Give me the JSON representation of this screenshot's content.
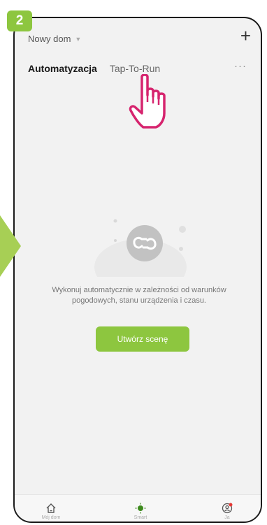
{
  "step_number": "2",
  "colors": {
    "accent": "#8dc63f",
    "hand": "#d6246e",
    "background": "#f2f2f2"
  },
  "header": {
    "home_name": "Nowy dom",
    "add_icon": "plus-icon"
  },
  "tabs": [
    {
      "label": "Automatyzacja",
      "active": true
    },
    {
      "label": "Tap-To-Run",
      "active": false
    }
  ],
  "empty_state": {
    "icon": "loop-icon",
    "text": "Wykonuj automatycznie w zależności od warunków pogodowych, stanu urządzenia i czasu.",
    "button_label": "Utwórz scenę"
  },
  "bottom_nav": [
    {
      "label": "Mój dom",
      "icon": "home-icon"
    },
    {
      "label": "Smart",
      "icon": "sun-icon"
    },
    {
      "label": "Ja",
      "icon": "profile-icon"
    }
  ]
}
